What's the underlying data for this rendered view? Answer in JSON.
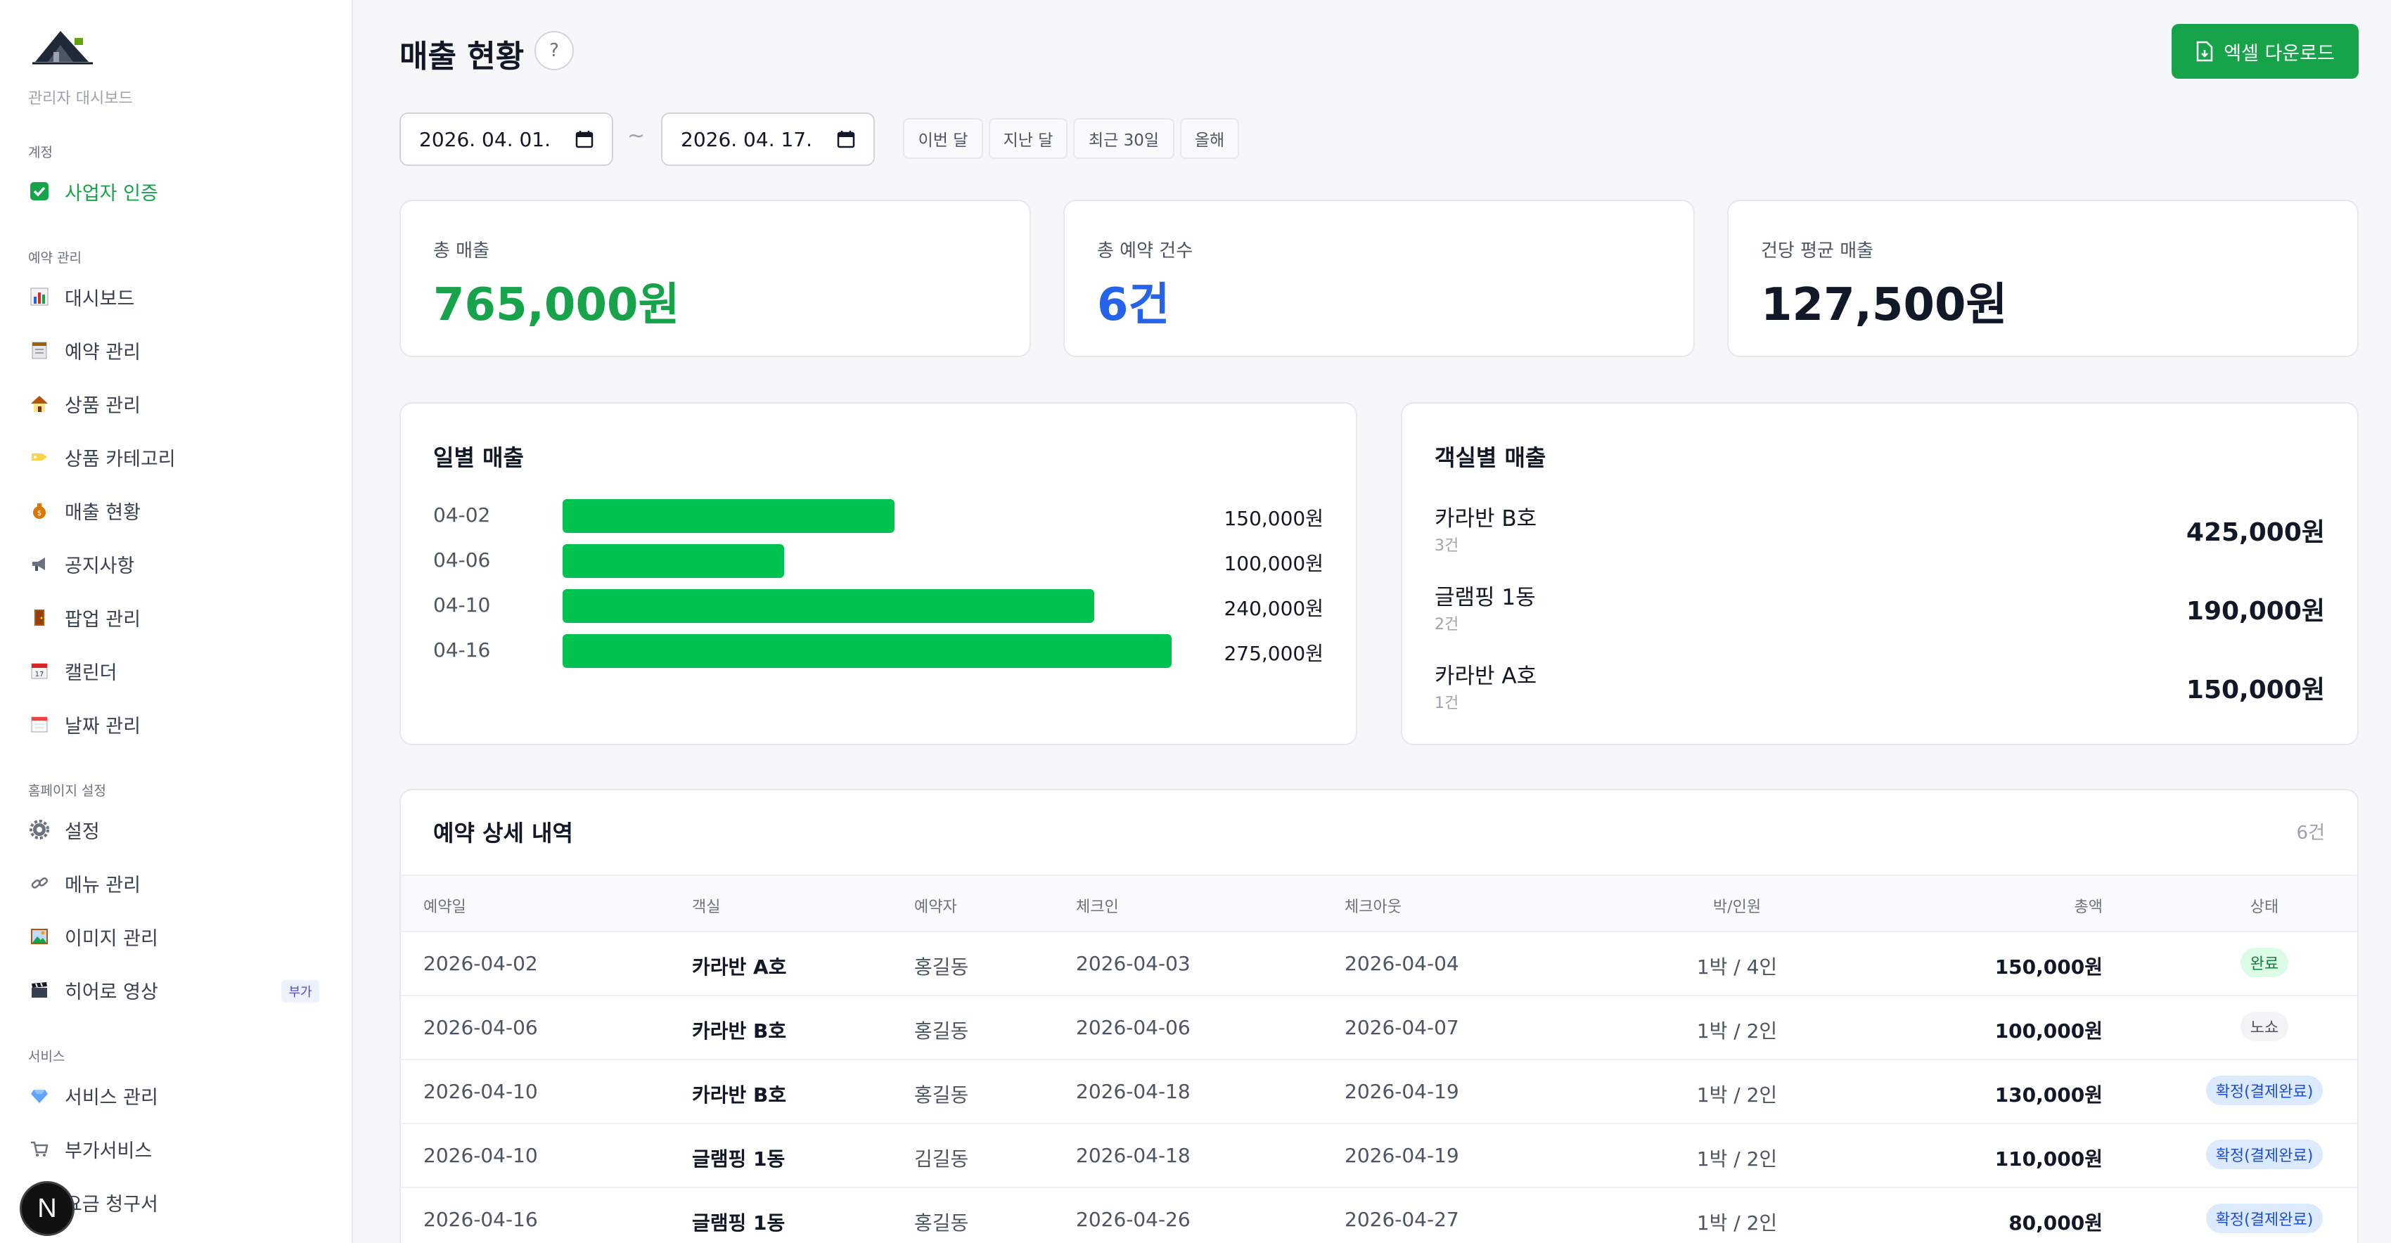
{
  "sidebar": {
    "subtitle": "관리자 대시보드",
    "sections": {
      "account": "계정",
      "reservation": "예약 관리",
      "homepage": "홈페이지 설정",
      "service": "서비스"
    },
    "items": [
      {
        "label": "사업자 인증",
        "icon": "check-box-icon"
      },
      {
        "label": "대시보드",
        "icon": "bar-chart-icon"
      },
      {
        "label": "예약 관리",
        "icon": "notepad-icon"
      },
      {
        "label": "상품 관리",
        "icon": "house-icon"
      },
      {
        "label": "상품 카테고리",
        "icon": "tag-icon"
      },
      {
        "label": "매출 현황",
        "icon": "money-bag-icon"
      },
      {
        "label": "공지사항",
        "icon": "megaphone-icon"
      },
      {
        "label": "팝업 관리",
        "icon": "door-icon"
      },
      {
        "label": "캘린더",
        "icon": "calendar-icon"
      },
      {
        "label": "날짜 관리",
        "icon": "date-icon"
      },
      {
        "label": "설정",
        "icon": "gear-icon"
      },
      {
        "label": "메뉴 관리",
        "icon": "link-icon"
      },
      {
        "label": "이미지 관리",
        "icon": "image-icon"
      },
      {
        "label": "히어로 영상",
        "icon": "clapper-icon",
        "badge": "부가"
      },
      {
        "label": "서비스 관리",
        "icon": "gem-icon"
      },
      {
        "label": "부가서비스",
        "icon": "cart-icon"
      },
      {
        "label": "요금 청구서",
        "icon": "invoice-icon"
      }
    ],
    "next_badge": "N"
  },
  "header": {
    "title": "매출 현황",
    "help": "?",
    "excel_button": "엑셀 다운로드"
  },
  "filters": {
    "start_date": "2026. 04. 01.",
    "end_date": "2026. 04. 17.",
    "separator": "~",
    "presets": [
      "이번 달",
      "지난 달",
      "최근 30일",
      "올해"
    ]
  },
  "stats": [
    {
      "label": "총 매출",
      "value": "765,000원",
      "color": "#16a34a"
    },
    {
      "label": "총 예약 건수",
      "value": "6건",
      "color": "#2563eb"
    },
    {
      "label": "건당 평균 매출",
      "value": "127,500원",
      "color": "#111827"
    }
  ],
  "daily": {
    "title": "일별 매출",
    "max": 275000,
    "rows": [
      {
        "date": "04-02",
        "amount": 150000,
        "label": "150,000원"
      },
      {
        "date": "04-06",
        "amount": 100000,
        "label": "100,000원"
      },
      {
        "date": "04-10",
        "amount": 240000,
        "label": "240,000원"
      },
      {
        "date": "04-16",
        "amount": 275000,
        "label": "275,000원"
      }
    ]
  },
  "rooms": {
    "title": "객실별 매출",
    "rows": [
      {
        "name": "카라반 B호",
        "count": "3건",
        "amount": "425,000원"
      },
      {
        "name": "글램핑 1동",
        "count": "2건",
        "amount": "190,000원"
      },
      {
        "name": "카라반 A호",
        "count": "1건",
        "amount": "150,000원"
      }
    ]
  },
  "detail": {
    "title": "예약 상세 내역",
    "count": "6건",
    "columns": [
      "예약일",
      "객실",
      "예약자",
      "체크인",
      "체크아웃",
      "박/인원",
      "총액",
      "상태"
    ],
    "rows": [
      {
        "date": "2026-04-02",
        "room": "카라반 A호",
        "guest": "홍길동",
        "checkin": "2026-04-03",
        "checkout": "2026-04-04",
        "nights": "1박 / 4인",
        "total": "150,000원",
        "status": "완료",
        "status_type": "done"
      },
      {
        "date": "2026-04-06",
        "room": "카라반 B호",
        "guest": "홍길동",
        "checkin": "2026-04-06",
        "checkout": "2026-04-07",
        "nights": "1박 / 2인",
        "total": "100,000원",
        "status": "노쇼",
        "status_type": "noshow"
      },
      {
        "date": "2026-04-10",
        "room": "카라반 B호",
        "guest": "홍길동",
        "checkin": "2026-04-18",
        "checkout": "2026-04-19",
        "nights": "1박 / 2인",
        "total": "130,000원",
        "status": "확정(결제완료)",
        "status_type": "confirmed"
      },
      {
        "date": "2026-04-10",
        "room": "글램핑 1동",
        "guest": "김길동",
        "checkin": "2026-04-18",
        "checkout": "2026-04-19",
        "nights": "1박 / 2인",
        "total": "110,000원",
        "status": "확정(결제완료)",
        "status_type": "confirmed"
      },
      {
        "date": "2026-04-16",
        "room": "글램핑 1동",
        "guest": "홍길동",
        "checkin": "2026-04-26",
        "checkout": "2026-04-27",
        "nights": "1박 / 2인",
        "total": "80,000원",
        "status": "확정(결제완료)",
        "status_type": "confirmed"
      }
    ]
  },
  "status_colors": {
    "done": {
      "bg": "#dcfce7",
      "fg": "#15803d"
    },
    "noshow": {
      "bg": "#f3f4f6",
      "fg": "#4b5563"
    },
    "confirmed": {
      "bg": "#dbeafe",
      "fg": "#1d4ed8"
    }
  }
}
